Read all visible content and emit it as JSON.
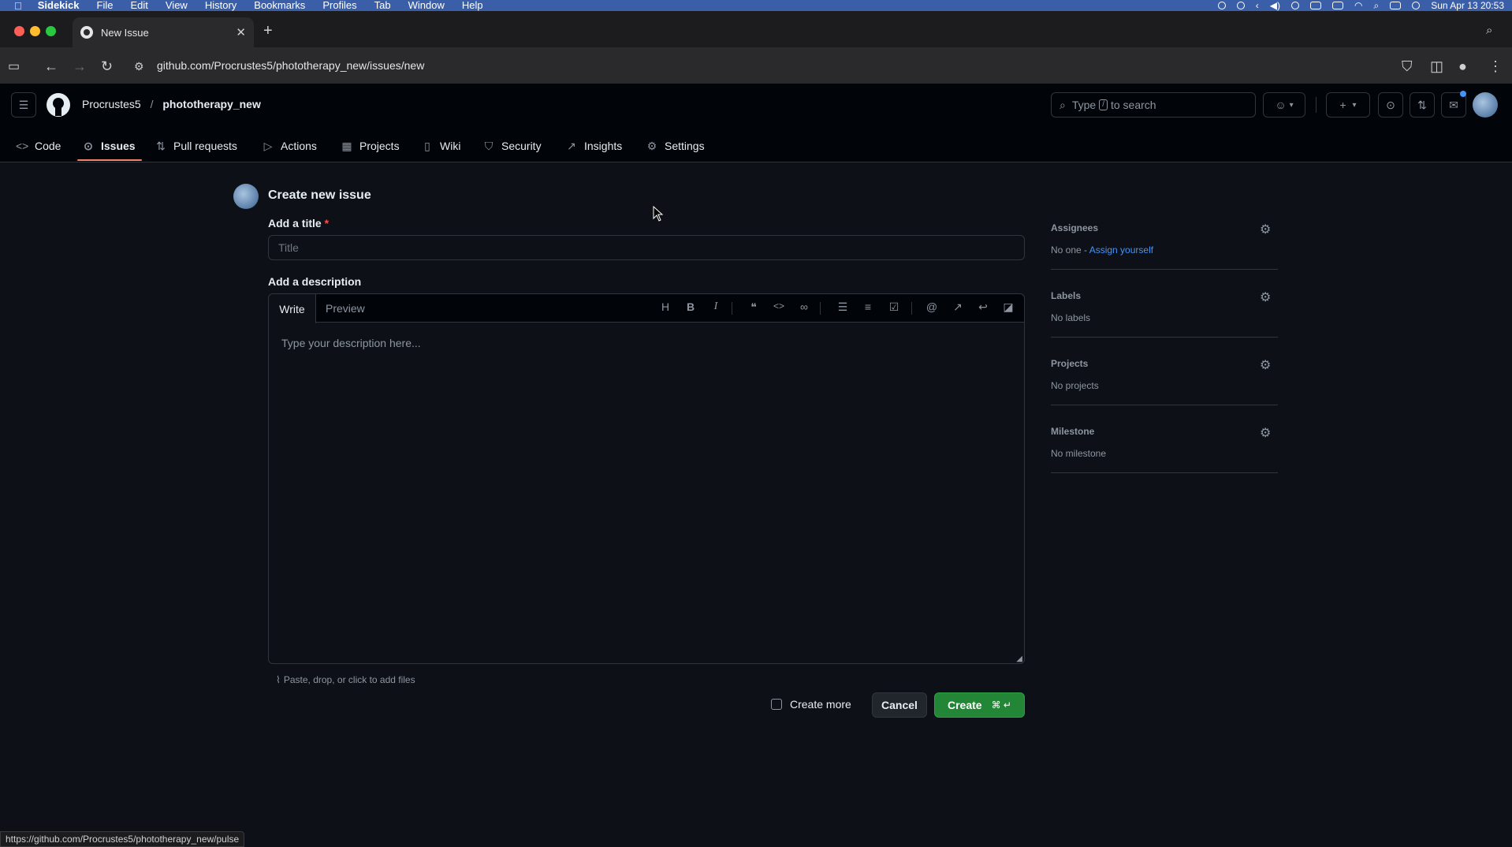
{
  "menubar": {
    "app": "Sidekick",
    "items": [
      "File",
      "Edit",
      "View",
      "History",
      "Bookmarks",
      "Profiles",
      "Tab",
      "Window",
      "Help"
    ],
    "clock": "Sun Apr 13  20:53"
  },
  "browser": {
    "tab_title": "New Issue",
    "url": "github.com/Procrustes5/phototherapy_new/issues/new",
    "status_url": "https://github.com/Procrustes5/phototherapy_new/pulse"
  },
  "header": {
    "owner": "Procrustes5",
    "separator": "/",
    "repo": "phototherapy_new",
    "search_prefix": "Type",
    "search_key": "/",
    "search_suffix": "to search"
  },
  "repo_nav": [
    {
      "label": "Code",
      "icon": "code-icon"
    },
    {
      "label": "Issues",
      "icon": "issue-icon"
    },
    {
      "label": "Pull requests",
      "icon": "pull-request-icon"
    },
    {
      "label": "Actions",
      "icon": "play-icon"
    },
    {
      "label": "Projects",
      "icon": "table-icon"
    },
    {
      "label": "Wiki",
      "icon": "book-icon"
    },
    {
      "label": "Security",
      "icon": "shield-icon"
    },
    {
      "label": "Insights",
      "icon": "graph-icon"
    },
    {
      "label": "Settings",
      "icon": "gear-icon"
    }
  ],
  "form": {
    "heading": "Create new issue",
    "title_label": "Add a title",
    "required_mark": "*",
    "title_placeholder": "Title",
    "description_label": "Add a description",
    "tab_write": "Write",
    "tab_preview": "Preview",
    "description_placeholder": "Type your description here...",
    "attach_text": "Paste, drop, or click to add files",
    "create_more": "Create more",
    "cancel": "Cancel",
    "create": "Create",
    "create_shortcut": "⌘ ↵"
  },
  "sidebar": {
    "assignees": {
      "heading": "Assignees",
      "value": "No one - ",
      "link": "Assign yourself"
    },
    "labels": {
      "heading": "Labels",
      "value": "No labels"
    },
    "projects": {
      "heading": "Projects",
      "value": "No projects"
    },
    "milestone": {
      "heading": "Milestone",
      "value": "No milestone"
    }
  },
  "colors": {
    "background": "#0d1117",
    "header": "#010409",
    "accent_underline": "#f78166",
    "create_button": "#238636",
    "link": "#4493f8"
  }
}
